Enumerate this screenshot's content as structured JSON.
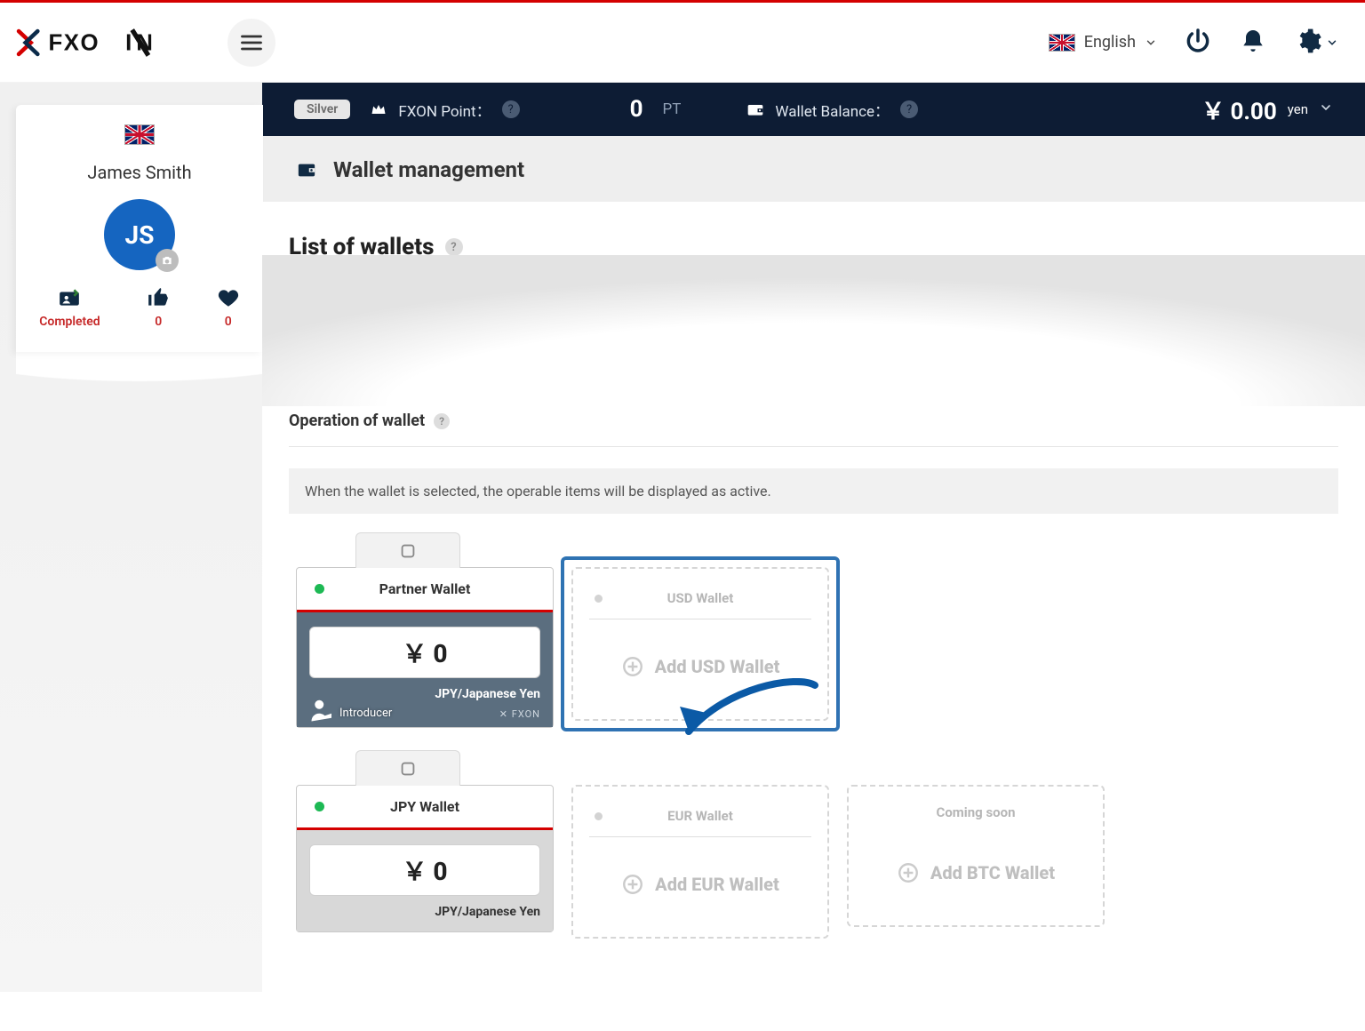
{
  "topbar": {
    "language": "English"
  },
  "infobar": {
    "badge": "Silver",
    "point_label": "FXON Point：",
    "point_value": "0",
    "point_unit": "PT",
    "balance_label": "Wallet Balance：",
    "balance_value": "￥ 0.00",
    "balance_unit": "yen"
  },
  "sidebar": {
    "user_name": "James Smith",
    "avatar_initials": "JS",
    "stats": {
      "completed": "Completed",
      "likes": "0",
      "hearts": "0"
    }
  },
  "page": {
    "title": "Wallet management",
    "list_title": "List of wallets",
    "op_title": "Operation of wallet",
    "info": "When the wallet is selected, the operable items will be displayed as active."
  },
  "wallets": {
    "partner": {
      "title": "Partner Wallet",
      "amount": "￥ 0",
      "currency": "JPY/Japanese Yen",
      "introducer": "Introducer",
      "brand": "✕ FXON"
    },
    "usd": {
      "title": "USD Wallet",
      "add": "Add USD Wallet"
    },
    "jpy": {
      "title": "JPY Wallet",
      "amount": "￥ 0",
      "currency": "JPY/Japanese Yen"
    },
    "eur": {
      "title": "EUR Wallet",
      "add": "Add EUR Wallet"
    },
    "btc": {
      "title": "Coming soon",
      "add": "Add BTC Wallet"
    }
  }
}
